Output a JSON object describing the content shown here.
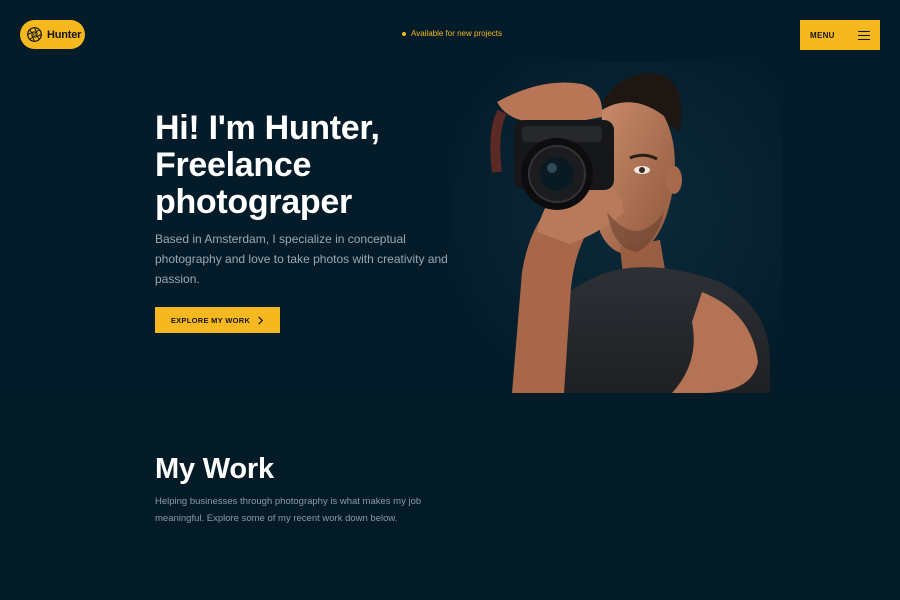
{
  "header": {
    "logo_text": "Hunter",
    "availability": "Available for new projects",
    "menu_label": "MENU"
  },
  "hero": {
    "headline_lines": [
      "Hi! I'm Hunter,",
      "Freelance",
      "photograper"
    ],
    "intro": "Based in Amsterdam, I specialize in conceptual photography and love to take photos with creativity and passion.",
    "cta_label": "EXPLORE MY WORK"
  },
  "work": {
    "title": "My Work",
    "description": "Helping businesses through photography is what makes my job meaningful. Explore some of my recent work down below."
  },
  "icons": {
    "logo": "aperture-icon",
    "availability": "status-dot-icon",
    "menu": "hamburger-icon",
    "cta": "chevron-right-icon"
  },
  "colors": {
    "accent": "#f5b81e",
    "hero_background": "#041c2a",
    "page_background": "#031a27",
    "text_primary": "#ffffff",
    "text_muted": "#9aa7b2"
  }
}
